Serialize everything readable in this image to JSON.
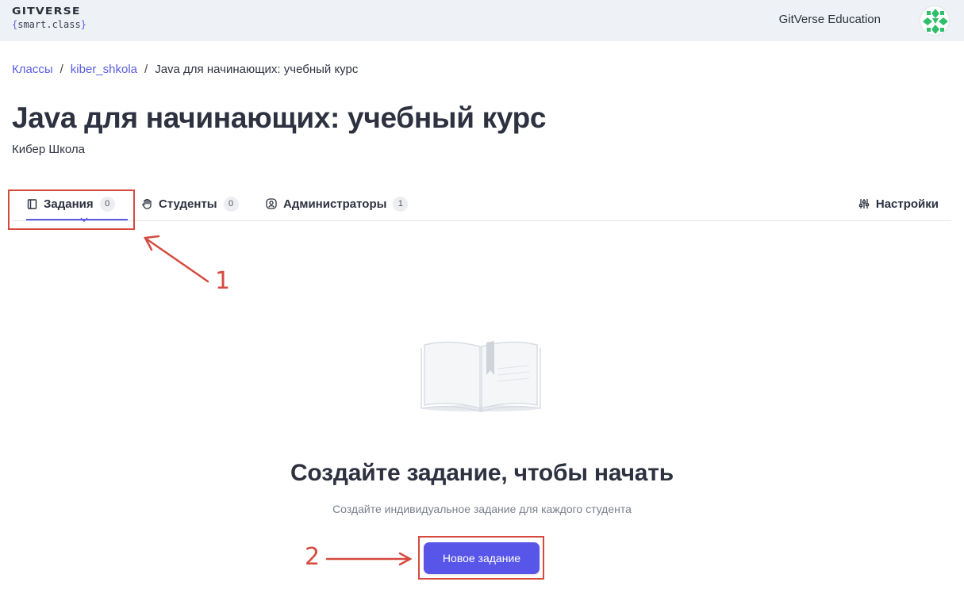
{
  "header": {
    "logo_main": "GITVERSE",
    "logo_open": "{",
    "logo_sub": "smart.class",
    "logo_close": "}",
    "education_link": "GitVerse Education"
  },
  "breadcrumb": {
    "items": [
      "Классы",
      "kiber_shkola",
      "Java для начинающих: учебный курс"
    ],
    "separator": "/"
  },
  "page": {
    "title": "Java для начинающих: учебный курс",
    "subtitle": "Кибер Школа"
  },
  "tabs": [
    {
      "label": "Задания",
      "count": "0",
      "icon": "book-icon",
      "active": true
    },
    {
      "label": "Студенты",
      "count": "0",
      "icon": "hand-icon",
      "active": false
    },
    {
      "label": "Администраторы",
      "count": "1",
      "icon": "user-circle-icon",
      "active": false
    },
    {
      "label": "Настройки",
      "icon": "sliders-icon",
      "active": false
    }
  ],
  "empty_state": {
    "illustration": "open-book",
    "title": "Создайте задание, чтобы начать",
    "description": "Создайте индивидуальное задание для каждого студента",
    "button_label": "Новое задание"
  },
  "annotations": {
    "marker_1": "1",
    "marker_2": "2",
    "color": "#d64a3e"
  },
  "colors": {
    "accent": "#5a5ce0",
    "button": "#5856e8",
    "topbar": "#eef1f5"
  }
}
